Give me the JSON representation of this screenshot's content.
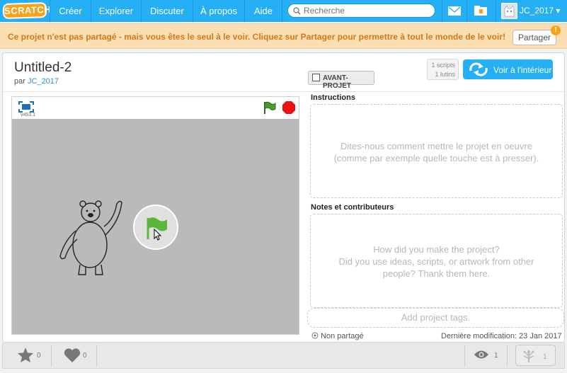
{
  "nav": {
    "logo": "SCRATCH",
    "items": [
      "Créer",
      "Explorer",
      "Discuter",
      "À propos",
      "Aide"
    ],
    "search_placeholder": "Recherche",
    "user": "JC_2017 ▾"
  },
  "banner": {
    "text": "Ce projet n'est pas partagé - mais vous êtes le seul à le voir. Cliquez sur Partager pour permettre à tout le monde de le voir!",
    "share_label": "Partager",
    "info": "!"
  },
  "project": {
    "title": "Untitled-2",
    "by_prefix": "par",
    "author": "JC_2017",
    "draft_label": "AVANT-PROJET",
    "scripts": "1 scripts",
    "sprites": "1 lutins",
    "inside_label": "Voir à l'intérieur",
    "version": "v453.1"
  },
  "instructions": {
    "label": "Instructions",
    "placeholder_line1": "Dites-nous comment mettre le projet en oeuvre",
    "placeholder_line2": "(comme par exemple quelle touche est à presser)."
  },
  "notes": {
    "label": "Notes et contributeurs",
    "placeholder_line1": "How did you make the project?",
    "placeholder_line2": "Did you use ideas, scripts, or artwork from other",
    "placeholder_line3": "people? Thank them here."
  },
  "tags_placeholder": "Add project tags.",
  "status": {
    "shared": "Non partagé",
    "last_modified": "Dernière modification: 23 Jan 2017"
  },
  "bottom": {
    "favorites": "0",
    "loves": "0",
    "views": "1",
    "remixes": "1"
  },
  "colors": {
    "nav": "#25aff4",
    "banner_bg": "#fbdfb2",
    "banner_text": "#d1781c",
    "flag_green": "#4a9b2f",
    "stop_red": "#e81313"
  },
  "icons": [
    "search-icon",
    "envelope-icon",
    "folder-icon",
    "fullscreen-icon",
    "green-flag-icon",
    "stop-icon",
    "remix-icon",
    "star-icon",
    "heart-icon",
    "eye-icon",
    "remix-tree-icon"
  ]
}
